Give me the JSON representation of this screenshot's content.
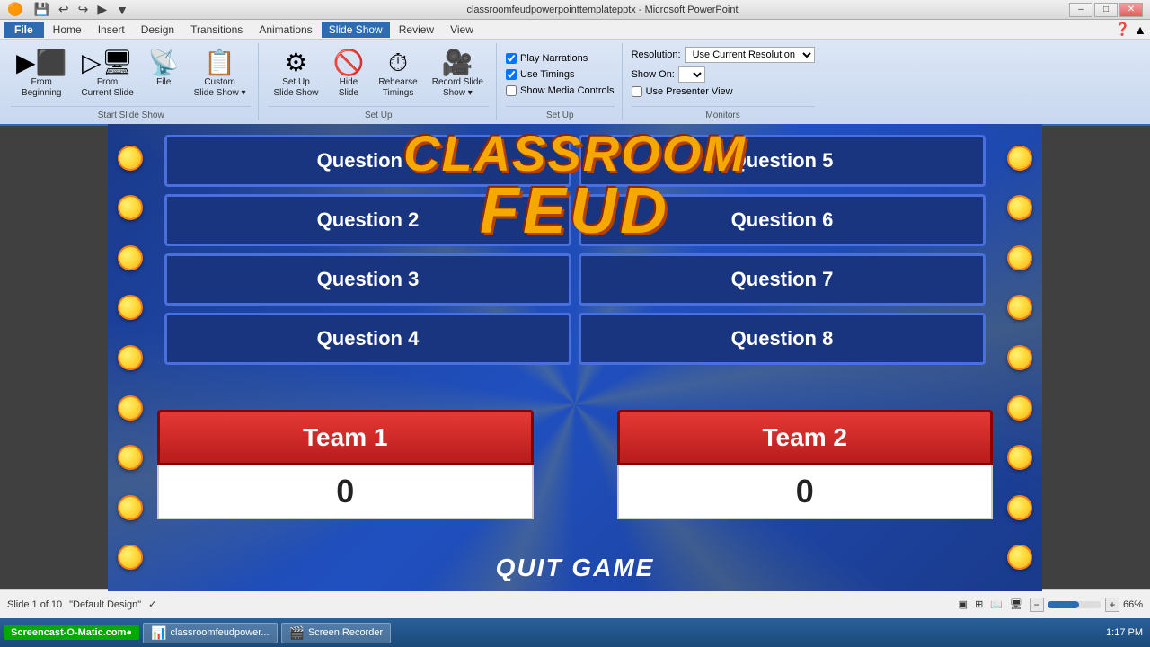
{
  "window": {
    "title": "classroomfeudpowerpointtemplatepptx - Microsoft PowerPoint",
    "controls": [
      "–",
      "□",
      "✕"
    ]
  },
  "quickAccess": {
    "buttons": [
      "💾",
      "↩",
      "↪",
      "▶",
      "▼"
    ]
  },
  "menuBar": {
    "items": [
      "File",
      "Home",
      "Insert",
      "Design",
      "Transitions",
      "Animations",
      "Slide Show",
      "Review",
      "View"
    ],
    "active": "Slide Show"
  },
  "ribbon": {
    "groups": [
      {
        "label": "Start Slide Show",
        "buttons": [
          {
            "label": "From\nBeginning",
            "icon": "▶"
          },
          {
            "label": "From\nCurrent Slide",
            "icon": "▶"
          },
          {
            "label": "Broadcast\nSlide Show",
            "icon": "📡"
          },
          {
            "label": "Custom\nSlide Show ▾",
            "icon": "📋"
          }
        ]
      },
      {
        "label": "Set Up",
        "buttons": [
          {
            "label": "Set Up\nSlide Show",
            "icon": "⚙"
          },
          {
            "label": "Hide\nSlide",
            "icon": "🚫"
          },
          {
            "label": "Rehearse\nTimings",
            "icon": "⏱"
          },
          {
            "label": "Record Slide\nShow ▾",
            "icon": "🔴"
          }
        ]
      },
      {
        "label": "Set Up",
        "checkboxes": [
          {
            "label": "Play Narrations",
            "checked": true
          },
          {
            "label": "Use Timings",
            "checked": true
          },
          {
            "label": "Show Media Controls",
            "checked": false
          }
        ]
      },
      {
        "label": "Monitors",
        "resolution": {
          "label": "Resolution:",
          "value": "Use Current Resolution"
        },
        "showOn": {
          "label": "Show On:",
          "value": ""
        },
        "presenterView": {
          "label": "Use Presenter View",
          "checked": false
        }
      }
    ]
  },
  "slide": {
    "questions": [
      "Question 1",
      "Question 5",
      "Question 2",
      "Question 6",
      "Question 3",
      "Question 7",
      "Question 4",
      "Question 8"
    ],
    "title": {
      "line1": "CLASSROOM",
      "line2": "FEUD"
    },
    "team1": {
      "label": "Team 1",
      "score": "0"
    },
    "team2": {
      "label": "Team 2",
      "score": "0"
    },
    "quitLabel": "QUIT GAME"
  },
  "statusBar": {
    "slideInfo": "Slide 1 of 10",
    "theme": "\"Default Design\"",
    "zoom": "66%"
  },
  "taskbar": {
    "brand": "Screencast-O-Matic.com●",
    "items": [
      {
        "label": "classroomfeudpower...",
        "icon": "📊"
      },
      {
        "label": "Screen Recorder",
        "icon": "🎬"
      }
    ],
    "time": "1:17 PM"
  }
}
